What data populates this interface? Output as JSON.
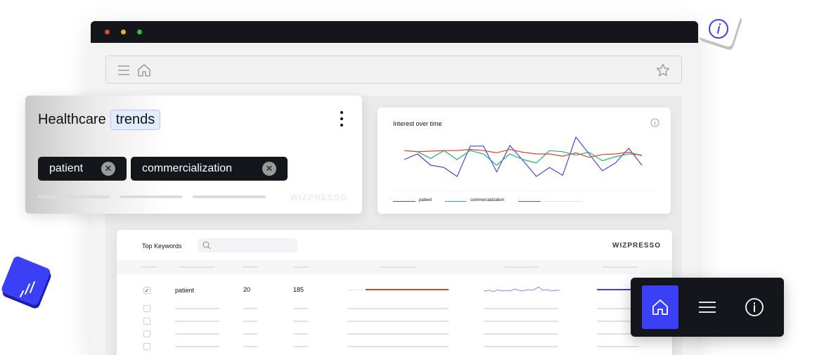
{
  "colors": {
    "accent": "#3b3ff5",
    "dark": "#15161c",
    "series_patient": "#4a45e6",
    "series_commercialization": "#1fb37a",
    "series_third": "#e0412f"
  },
  "healthcare": {
    "title": "Healthcare",
    "badge": "trends",
    "chips": [
      "patient",
      "commercialization"
    ],
    "watermark": "WIZPRESSO"
  },
  "interest": {
    "title": "Interest over time",
    "legend": [
      "patient",
      "commercialization",
      ""
    ],
    "chart_data": {
      "type": "line",
      "title": "Interest over time",
      "xlabel": "",
      "ylabel": "",
      "x": [
        1,
        2,
        3,
        4,
        5,
        6,
        7,
        8,
        9,
        10,
        11,
        12,
        13,
        14,
        15,
        16,
        17,
        18,
        19
      ],
      "series": [
        {
          "name": "patient",
          "values": [
            50,
            60,
            40,
            36,
            20,
            74,
            74,
            28,
            75,
            48,
            20,
            36,
            22,
            90,
            60,
            30,
            44,
            70,
            40
          ]
        },
        {
          "name": "commercialization",
          "values": [
            66,
            64,
            52,
            66,
            50,
            66,
            60,
            40,
            60,
            50,
            44,
            66,
            64,
            58,
            63,
            48,
            55,
            60,
            58
          ]
        },
        {
          "name": "",
          "values": [
            66,
            64,
            65,
            66,
            66,
            68,
            66,
            62,
            68,
            63,
            60,
            60,
            56,
            62,
            54,
            59,
            60,
            63,
            57
          ]
        }
      ],
      "ylim": [
        0,
        100
      ],
      "grid": false,
      "legend": "bottom"
    }
  },
  "keywords": {
    "title": "Top Keywords",
    "watermark": "WIZPRESSO",
    "row": {
      "keyword": "patient",
      "count": "20",
      "volume": "185"
    }
  },
  "toolbar": {
    "items": [
      "home-icon",
      "menu-icon",
      "info-icon"
    ]
  }
}
